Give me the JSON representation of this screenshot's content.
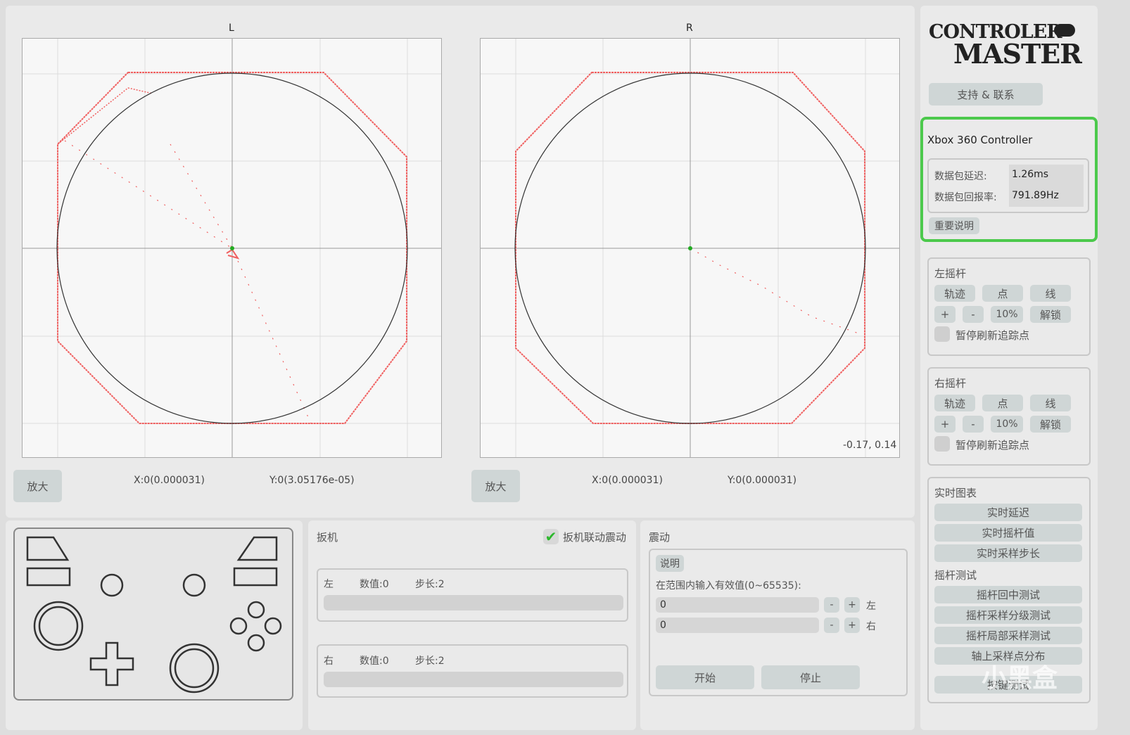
{
  "plots": {
    "left": {
      "title": "L",
      "zoom_label": "放大",
      "x_readout": "X:0(0.000031)",
      "y_readout": "Y:0(3.05176e-05)"
    },
    "right": {
      "title": "R",
      "zoom_label": "放大",
      "x_readout": "X:0(0.000031)",
      "y_readout": "Y:0(0.000031)",
      "cursor_readout": "-0.17, 0.14"
    }
  },
  "sidebar": {
    "logo_line1": "CONTROLER",
    "logo_line2": "MASTER",
    "support_label": "支持 & 联系",
    "device": {
      "name": "Xbox 360 Controller",
      "latency_label": "数据包延迟:",
      "latency_value": "1.26ms",
      "rate_label": "数据包回报率:",
      "rate_value": "791.89Hz",
      "notice_label": "重要说明"
    },
    "left_stick": {
      "title": "左摇杆",
      "trail": "轨迹",
      "point": "点",
      "line": "线",
      "plus": "+",
      "minus": "-",
      "percent": "10%",
      "unlock": "解锁",
      "pause": "暂停刷新追踪点"
    },
    "right_stick": {
      "title": "右摇杆",
      "trail": "轨迹",
      "point": "点",
      "line": "线",
      "plus": "+",
      "minus": "-",
      "percent": "10%",
      "unlock": "解锁",
      "pause": "暂停刷新追踪点"
    },
    "realtime": {
      "title": "实时图表",
      "latency": "实时延迟",
      "stick_value": "实时摇杆值",
      "sample_step": "实时采样步长"
    },
    "stick_test": {
      "title": "摇杆测试",
      "center": "摇杆回中测试",
      "grading": "摇杆采样分级测试",
      "local": "摇杆局部采样测试",
      "axis": "轴上采样点分布",
      "key": "按键测试"
    }
  },
  "trigger": {
    "title": "扳机",
    "link_vibration": "扳机联动震动",
    "left": {
      "side": "左",
      "value": "数值:0",
      "step": "步长:2"
    },
    "right": {
      "side": "右",
      "value": "数值:0",
      "step": "步长:2"
    }
  },
  "vibration": {
    "title": "震动",
    "help": "说明",
    "hint": "在范围内输入有效值(0~65535):",
    "left_value": "0",
    "right_value": "0",
    "minus": "-",
    "plus": "+",
    "left_label": "左",
    "right_label": "右",
    "start": "开始",
    "stop": "停止"
  },
  "watermark": "小黑盒",
  "colors": {
    "accent_green": "#4cc94c",
    "trace_red": "#f06060",
    "center_green": "#22aa22"
  }
}
